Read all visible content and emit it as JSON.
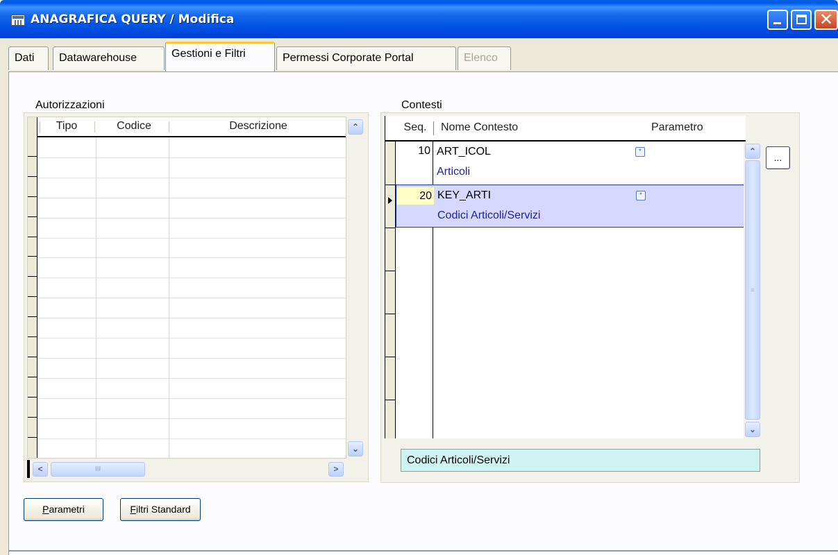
{
  "window": {
    "title": "ANAGRAFICA QUERY / Modifica",
    "close_glyph": "✕"
  },
  "tabs": [
    {
      "label": "Dati",
      "state": "normal"
    },
    {
      "label": "Datawarehouse",
      "state": "normal"
    },
    {
      "label": "Gestioni e Filtri",
      "state": "active"
    },
    {
      "label": "Permessi Corporate Portal",
      "state": "normal"
    },
    {
      "label": "Elenco",
      "state": "disabled"
    }
  ],
  "autorizzazioni": {
    "label": "Autorizzazioni",
    "columns": [
      "Tipo",
      "Codice",
      "Descrizione"
    ],
    "rows": [],
    "scroll_glyphs": {
      "up": "⌃",
      "down": "⌄",
      "left": "<",
      "right": ">",
      "thumb": "III"
    }
  },
  "contesti": {
    "label": "Contesti",
    "columns": [
      "Seq.",
      "Nome Contesto",
      "Parametro"
    ],
    "rows": [
      {
        "seq": "10",
        "nome": "ART_ICOL",
        "descrizione": "Articoli",
        "param_icon": "*"
      },
      {
        "seq": "20",
        "nome": "KEY_ARTI",
        "descrizione": "Codici Articoli/Servizi",
        "param_icon": "*",
        "selected": true
      }
    ],
    "ellipsis_label": "...",
    "status_text": "Codici Articoli/Servizi",
    "thumb_glyph": "≡"
  },
  "buttons": {
    "parametri": {
      "accel": "P",
      "rest": "arametri"
    },
    "filtri": {
      "accel": "F",
      "rest": "iltri Standard"
    }
  },
  "colors": {
    "titlebar": "#0053e1",
    "active_tab_accent": "#ffc83c",
    "selected_row": "#d6d8fd",
    "status_box": "#cff3f1"
  }
}
